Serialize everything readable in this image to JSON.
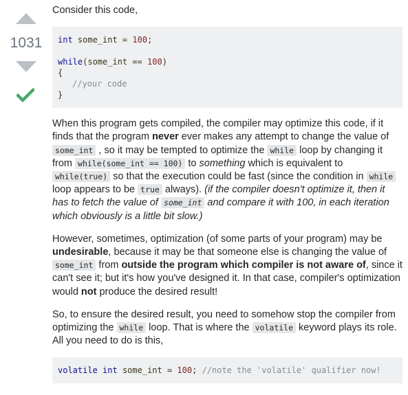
{
  "vote": {
    "count": "1031",
    "up_icon": "arrow-up-icon",
    "down_icon": "arrow-down-icon",
    "accepted_icon": "checkmark-icon",
    "arrow_color": "#bbc0c4",
    "accepted_color": "#48a868"
  },
  "intro": "Consider this code,",
  "code1": {
    "l1_type": "int",
    "l1_rest": " some_int = ",
    "l1_num": "100",
    "l1_end": ";",
    "l2_kw": "while",
    "l2_rest": "(some_int == ",
    "l2_num": "100",
    "l2_end": ")",
    "l3": "{",
    "l4": "//your code",
    "l5": "}"
  },
  "para1": {
    "s1": "When this program gets compiled, the compiler may optimize this code, if it finds that the program ",
    "b1": "never",
    "s2": " ever makes any attempt to change the value of ",
    "c1": "some_int",
    "s3": " , so it may be tempted to optimize the ",
    "c2": "while",
    "s4": " loop by changing it from ",
    "c3": "while(some_int == 100)",
    "s5": " to ",
    "i1": "something",
    "s6": " which is equivalent to ",
    "c4": "while(true)",
    "s7": " so that the execution could be fast (since the condition in ",
    "c5": "while",
    "s8": " loop appears to be ",
    "c6": "true",
    "s9": " always). ",
    "i2": "(if the compiler doesn't optimize it, then it has to fetch the value of ",
    "c7": "some_int",
    "i3": " and compare it with 100, in each iteration which obviously is a little bit slow.)"
  },
  "para2": {
    "s1": "However, sometimes, optimization (of some parts of your program) may be ",
    "b1": "undesirable",
    "s2": ", because it may be that someone else is changing the value of ",
    "c1": "some_int",
    "s3": " from ",
    "b2": "outside the program which compiler is not aware of",
    "s4": ", since it can't see it; but it's how you've designed it. In that case, compiler's optimization would ",
    "b3": "not",
    "s5": " produce the desired result!"
  },
  "para3": {
    "s1": "So, to ensure the desired result, you need to somehow stop the compiler from optimizing the ",
    "c1": "while",
    "s2": " loop. That is where the ",
    "c2": "volatile",
    "s3": " keyword plays its role. All you need to do is this,"
  },
  "code2": {
    "kw1": "volatile",
    "sp1": " ",
    "kw2": "int",
    "rest": " some_int = ",
    "num": "100",
    "end": "; ",
    "cmt": "//note the 'volatile' qualifier now!"
  }
}
